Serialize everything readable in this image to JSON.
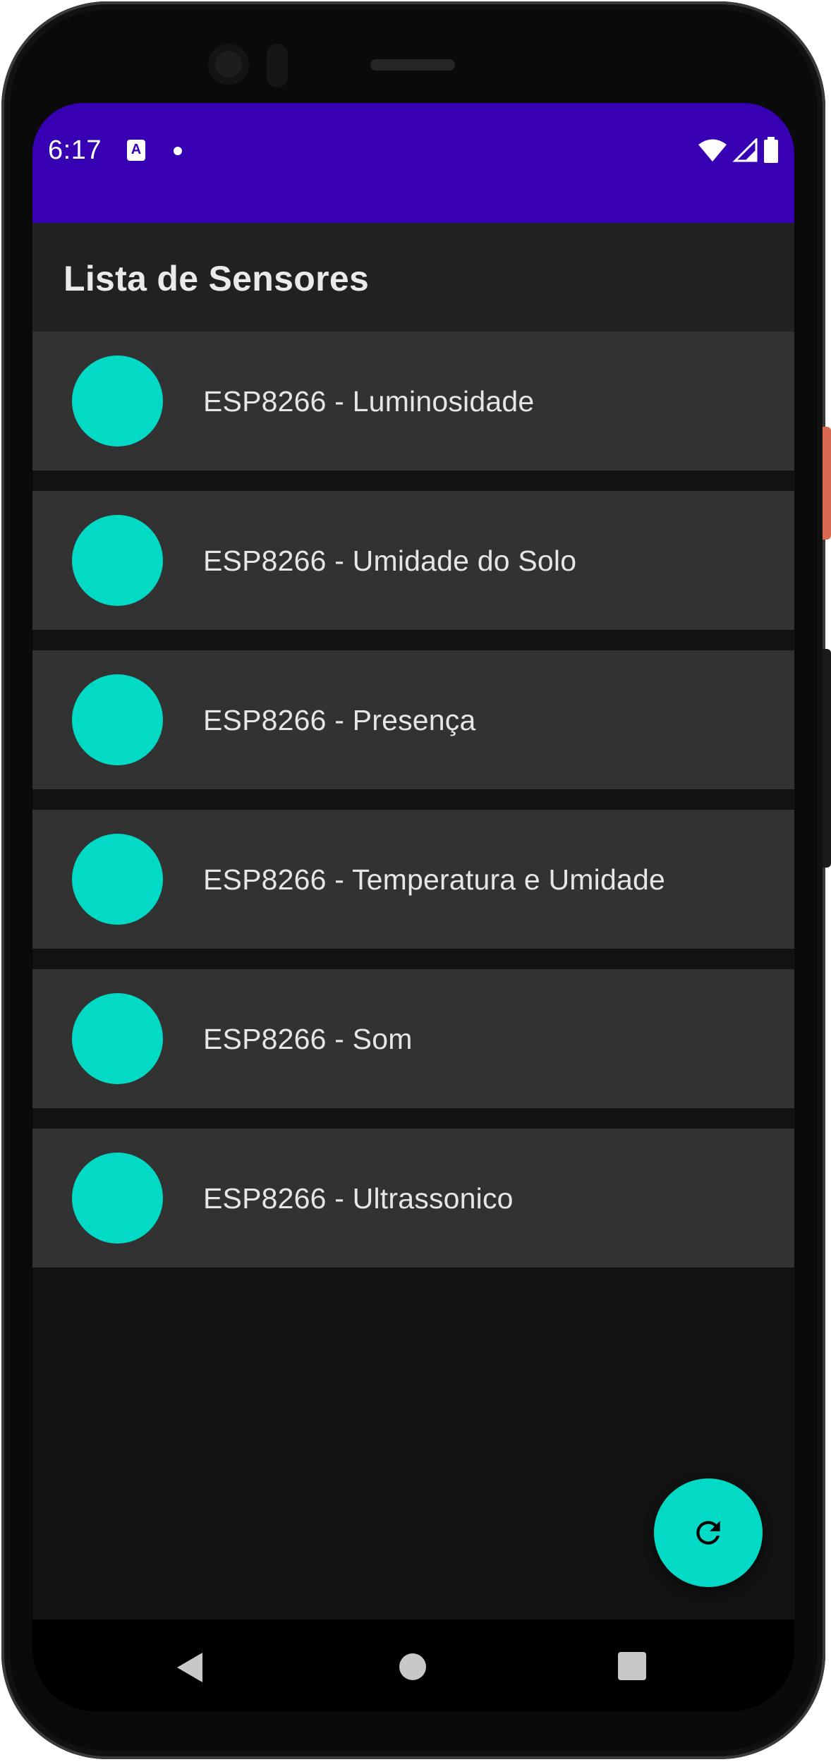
{
  "status_bar": {
    "time": "6:17",
    "notification_icon": "a-notification-icon",
    "notification_icon_glyph": "A",
    "icons": [
      "wifi-icon",
      "signal-icon",
      "battery-icon"
    ]
  },
  "app_bar": {
    "title": "Lista de Sensores"
  },
  "sensors": [
    {
      "label": "ESP8266 - Luminosidade"
    },
    {
      "label": "ESP8266 - Umidade do Solo"
    },
    {
      "label": "ESP8266 - Presença"
    },
    {
      "label": "ESP8266 - Temperatura e Umidade"
    },
    {
      "label": "ESP8266 - Som"
    },
    {
      "label": "ESP8266 - Ultrassonico"
    }
  ],
  "fab": {
    "icon": "refresh-icon"
  },
  "nav": {
    "back_icon": "back-icon",
    "home_icon": "home-icon",
    "recents_icon": "recents-icon"
  },
  "colors": {
    "status_bar": "#3700b3",
    "accent": "#03dac5",
    "background": "#121212",
    "app_bar": "#212121",
    "list_item": "#323232"
  }
}
